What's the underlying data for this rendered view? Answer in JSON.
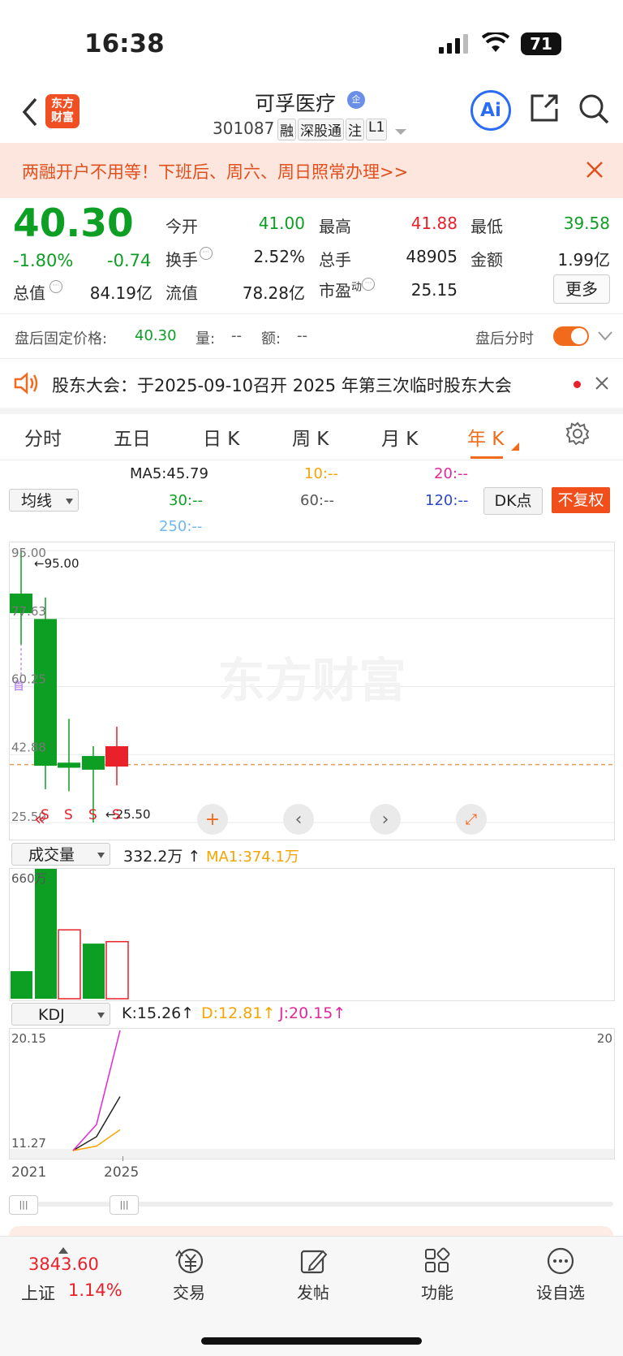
{
  "status": {
    "time": "16:38",
    "battery": "71"
  },
  "header": {
    "title": "可孚医疗",
    "code": "301087",
    "tags": [
      "融",
      "深股通",
      "注",
      "L1"
    ],
    "logo_text": [
      "东方",
      "财富"
    ],
    "ai_label": "Ai"
  },
  "promo": {
    "text": "两融开户不用等！下班后、周六、周日照常办理>>"
  },
  "quote": {
    "price": "40.30",
    "change_pct": "-1.80%",
    "change": "-0.74",
    "rows": [
      [
        {
          "label": "今开",
          "value": "41.00"
        },
        {
          "label": "最高",
          "value": "41.88"
        },
        {
          "label": "最低",
          "value": "39.58"
        }
      ],
      [
        {
          "label": "换手",
          "value": "2.52%"
        },
        {
          "label": "总手",
          "value": "48905"
        },
        {
          "label": "金额",
          "value": "1.99亿"
        }
      ],
      [
        {
          "label": "总值",
          "value": "84.19亿"
        },
        {
          "label": "流值",
          "value": "78.28亿"
        },
        {
          "label": "市盈动",
          "value": "25.15"
        }
      ]
    ],
    "more": "更多"
  },
  "after_hours": {
    "label": "盘后固定价格:",
    "price": "40.30",
    "vol_label": "量:",
    "vol": "--",
    "amt_label": "额:",
    "amt": "--",
    "toggle_label": "盘后分时"
  },
  "notice": {
    "text": "股东大会：于2025-09-10召开 2025 年第三次临时股东大会"
  },
  "tabs": [
    "分时",
    "五日",
    "日 K",
    "周 K",
    "月 K",
    "年 K"
  ],
  "active_tab": 5,
  "ma": {
    "selector": "均线",
    "ma5": "MA5:45.79",
    "ma10": "10:--",
    "ma20": "20:--",
    "ma30": "30:--",
    "ma60": "60:--",
    "ma120": "120:--",
    "ma250": "250:--",
    "dk": "DK点",
    "fq": "不复权"
  },
  "chart_data": [
    {
      "type": "candlestick",
      "y_ticks": [
        "95.00",
        "77.63",
        "60.25",
        "42.88",
        "25.50"
      ],
      "ylim": [
        25.5,
        95.0
      ],
      "high_label": "95.00",
      "low_label": "25.50",
      "last_price_line": 40.3,
      "watermark": "东方财富",
      "candles": [
        {
          "open": 84.0,
          "close": 79.0,
          "high": 95.0,
          "low": 71.0
        },
        {
          "open": 77.5,
          "close": 40.0,
          "high": 83.0,
          "low": 34.0
        },
        {
          "open": 40.8,
          "close": 39.5,
          "high": 52.0,
          "low": 33.5
        },
        {
          "open": 42.5,
          "close": 39.0,
          "high": 45.0,
          "low": 25.5
        },
        {
          "open": 39.8,
          "close": 45.0,
          "high": 50.0,
          "low": 35.0
        }
      ],
      "s_marks": [
        "S",
        "S",
        "S",
        "S"
      ],
      "flag_label": "首"
    },
    {
      "type": "bar",
      "selector": "成交量",
      "current": "332.2万",
      "ma1": "MA1:374.1万",
      "ymax_label": "660万",
      "ylim": [
        0,
        660
      ],
      "values": [
        140,
        660,
        350,
        280,
        290
      ],
      "colors": [
        "green",
        "green",
        "red",
        "green",
        "red"
      ]
    },
    {
      "type": "line",
      "selector": "KDJ",
      "k": "K:15.26",
      "d": "D:12.81",
      "j": "J:20.15",
      "ytop": "20.15",
      "ybottom": "11.27",
      "yright": "20",
      "x_labels": [
        "2021",
        "2025"
      ],
      "series": [
        {
          "name": "K",
          "values": [
            11.27,
            12.3,
            15.26
          ]
        },
        {
          "name": "D",
          "values": [
            11.27,
            11.6,
            12.81
          ]
        },
        {
          "name": "J",
          "values": [
            11.27,
            13.2,
            20.15
          ]
        }
      ]
    }
  ],
  "bottom": {
    "index_value": "3843.60",
    "index_name": "上证",
    "index_change": "1.14%",
    "items": [
      "交易",
      "发帖",
      "功能",
      "设自选"
    ]
  }
}
